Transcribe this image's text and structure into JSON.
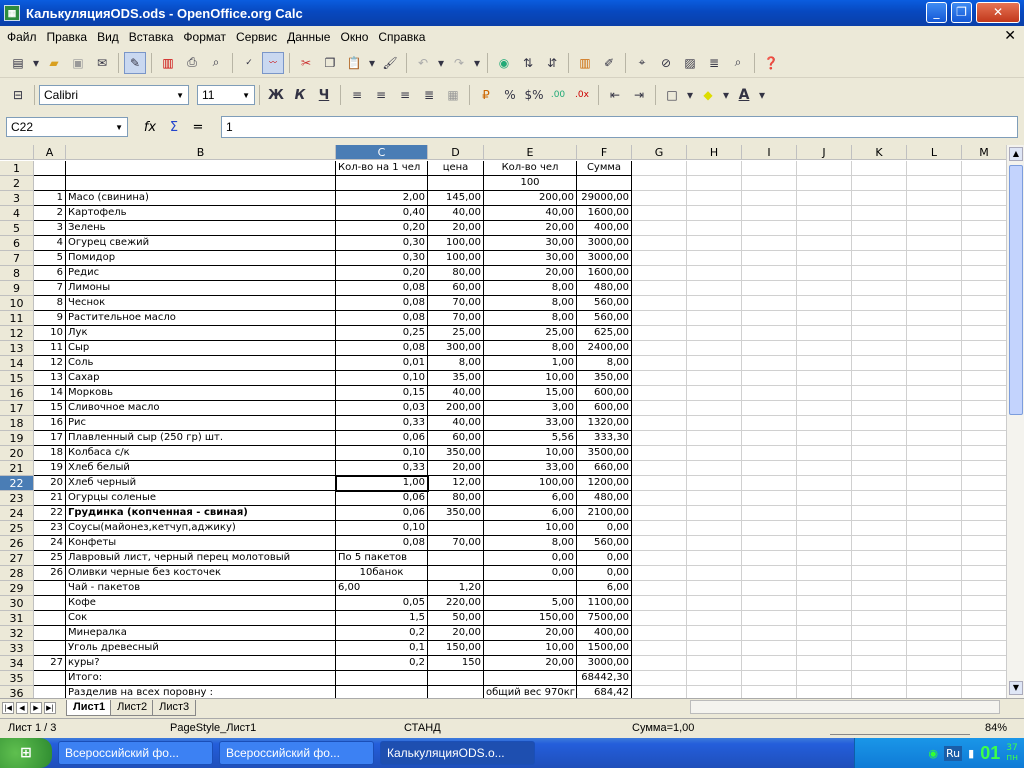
{
  "window": {
    "title": "КалькуляцияODS.ods - OpenOffice.org Calc"
  },
  "menu": [
    "Файл",
    "Правка",
    "Вид",
    "Вставка",
    "Формат",
    "Сервис",
    "Данные",
    "Окно",
    "Справка"
  ],
  "toolbar2": {
    "font": "Calibri",
    "size": "11",
    "bold": "Ж",
    "italic": "К",
    "underline": "Ч",
    "percent": "%"
  },
  "formula": {
    "cellref": "C22",
    "content": "1"
  },
  "columns": [
    {
      "id": "A",
      "w": 32
    },
    {
      "id": "B",
      "w": 270
    },
    {
      "id": "C",
      "w": 92
    },
    {
      "id": "D",
      "w": 56
    },
    {
      "id": "E",
      "w": 93
    },
    {
      "id": "F",
      "w": 55
    },
    {
      "id": "G",
      "w": 55
    },
    {
      "id": "H",
      "w": 55
    },
    {
      "id": "I",
      "w": 55
    },
    {
      "id": "J",
      "w": 55
    },
    {
      "id": "K",
      "w": 55
    },
    {
      "id": "L",
      "w": 55
    },
    {
      "id": "M",
      "w": 45
    }
  ],
  "rows": [
    {
      "n": "1",
      "a": "",
      "b": "",
      "c": "Кол-во на 1 чел",
      "d": "цена",
      "e": "Кол-во  чел",
      "f": "Сумма"
    },
    {
      "n": "2",
      "a": "",
      "b": "",
      "c": "",
      "d": "",
      "e": "100",
      "f": ""
    },
    {
      "n": "3",
      "a": "1",
      "b": "Масо (свинина)",
      "c": "2,00",
      "d": "145,00",
      "e": "200,00",
      "f": "29000,00"
    },
    {
      "n": "4",
      "a": "2",
      "b": "Картофель",
      "c": "0,40",
      "d": "40,00",
      "e": "40,00",
      "f": "1600,00"
    },
    {
      "n": "5",
      "a": "3",
      "b": "Зелень",
      "c": "0,20",
      "d": "20,00",
      "e": "20,00",
      "f": "400,00"
    },
    {
      "n": "6",
      "a": "4",
      "b": "Огурец свежий",
      "c": "0,30",
      "d": "100,00",
      "e": "30,00",
      "f": "3000,00"
    },
    {
      "n": "7",
      "a": "5",
      "b": "Помидор",
      "c": "0,30",
      "d": "100,00",
      "e": "30,00",
      "f": "3000,00"
    },
    {
      "n": "8",
      "a": "6",
      "b": "Редис",
      "c": "0,20",
      "d": "80,00",
      "e": "20,00",
      "f": "1600,00"
    },
    {
      "n": "9",
      "a": "7",
      "b": "Лимоны",
      "c": "0,08",
      "d": "60,00",
      "e": "8,00",
      "f": "480,00"
    },
    {
      "n": "10",
      "a": "8",
      "b": "Чеснок",
      "c": "0,08",
      "d": "70,00",
      "e": "8,00",
      "f": "560,00"
    },
    {
      "n": "11",
      "a": "9",
      "b": "Растительное масло",
      "c": "0,08",
      "d": "70,00",
      "e": "8,00",
      "f": "560,00"
    },
    {
      "n": "12",
      "a": "10",
      "b": "Лук",
      "c": "0,25",
      "d": "25,00",
      "e": "25,00",
      "f": "625,00"
    },
    {
      "n": "13",
      "a": "11",
      "b": "Сыр",
      "c": "0,08",
      "d": "300,00",
      "e": "8,00",
      "f": "2400,00"
    },
    {
      "n": "14",
      "a": "12",
      "b": "Соль",
      "c": "0,01",
      "d": "8,00",
      "e": "1,00",
      "f": "8,00"
    },
    {
      "n": "15",
      "a": "13",
      "b": "Сахар",
      "c": "0,10",
      "d": "35,00",
      "e": "10,00",
      "f": "350,00"
    },
    {
      "n": "16",
      "a": "14",
      "b": "Морковь",
      "c": "0,15",
      "d": "40,00",
      "e": "15,00",
      "f": "600,00"
    },
    {
      "n": "17",
      "a": "15",
      "b": "Сливочное масло",
      "c": "0,03",
      "d": "200,00",
      "e": "3,00",
      "f": "600,00"
    },
    {
      "n": "18",
      "a": "16",
      "b": "Рис",
      "c": "0,33",
      "d": "40,00",
      "e": "33,00",
      "f": "1320,00"
    },
    {
      "n": "19",
      "a": "17",
      "b": "Плавленный сыр (250 гр) шт.",
      "c": "0,06",
      "d": "60,00",
      "e": "5,56",
      "f": "333,30"
    },
    {
      "n": "20",
      "a": "18",
      "b": "Колбаса с/к",
      "c": "0,10",
      "d": "350,00",
      "e": "10,00",
      "f": "3500,00"
    },
    {
      "n": "21",
      "a": "19",
      "b": "Хлеб белый",
      "c": "0,33",
      "d": "20,00",
      "e": "33,00",
      "f": "660,00"
    },
    {
      "n": "22",
      "a": "20",
      "b": "Хлеб черный",
      "c": "1,00",
      "d": "12,00",
      "e": "100,00",
      "f": "1200,00"
    },
    {
      "n": "23",
      "a": "21",
      "b": "Огурцы соленые",
      "c": "0,06",
      "d": "80,00",
      "e": "6,00",
      "f": "480,00"
    },
    {
      "n": "24",
      "a": "22",
      "b": "Грудинка (копченная - свиная)",
      "c": "0,06",
      "d": "350,00",
      "e": "6,00",
      "f": "2100,00",
      "bold": true
    },
    {
      "n": "25",
      "a": "23",
      "b": "Соусы(майонез,кетчуп,аджику)",
      "c": "0,10",
      "d": "",
      "e": "10,00",
      "f": "0,00"
    },
    {
      "n": "26",
      "a": "24",
      "b": "Конфеты",
      "c": "0,08",
      "d": "70,00",
      "e": "8,00",
      "f": "560,00"
    },
    {
      "n": "27",
      "a": "25",
      "b": "Лавровый лист, черный перец молотовый",
      "c": "По 5 пакетов",
      "d": "",
      "e": "0,00",
      "f": "0,00",
      "cl": true
    },
    {
      "n": "28",
      "a": "26",
      "b": "Оливки черные без косточек",
      "c": "10банок",
      "d": "",
      "e": "0,00",
      "f": "0,00",
      "cc": true
    },
    {
      "n": "29",
      "a": "",
      "b": "Чай - пакетов",
      "c": "6,00",
      "d": "1,20",
      "e": "",
      "f": "6,00",
      "cl": true
    },
    {
      "n": "30",
      "a": "",
      "b": "Кофе",
      "c": "0,05",
      "d": "220,00",
      "e": "5,00",
      "f": "1100,00"
    },
    {
      "n": "31",
      "a": "",
      "b": "Сок",
      "c": "1,5",
      "d": "50,00",
      "e": "150,00",
      "f": "7500,00"
    },
    {
      "n": "32",
      "a": "",
      "b": "Минералка",
      "c": "0,2",
      "d": "20,00",
      "e": "20,00",
      "f": "400,00"
    },
    {
      "n": "33",
      "a": "",
      "b": "Уголь древесный",
      "c": "0,1",
      "d": "150,00",
      "e": "10,00",
      "f": "1500,00"
    },
    {
      "n": "34",
      "a": "27",
      "b": "куры?",
      "c": "0,2",
      "d": "150",
      "e": "20,00",
      "f": "3000,00"
    },
    {
      "n": "35",
      "a": "",
      "b": "Итого:",
      "c": "",
      "d": "",
      "e": "",
      "f": "68442,30"
    },
    {
      "n": "36",
      "a": "",
      "b": "Разделив на всех поровну :",
      "c": "",
      "d": "",
      "e": "общий вес 970кг.",
      "f": "684,42",
      "el": true
    }
  ],
  "tabs": [
    "Лист1",
    "Лист2",
    "Лист3"
  ],
  "status": {
    "sheet": "Лист 1 / 3",
    "style": "PageStyle_Лист1",
    "mode": "СТАНД",
    "sum": "Сумма=1,00",
    "zoom": "84%"
  },
  "taskbar": {
    "items": [
      "Всероссийский фо...",
      "Всероссийский фо...",
      "КалькуляцияODS.o..."
    ],
    "lang": "Ru",
    "clock": "01",
    "clock_small_top": "37",
    "clock_small_bottom": "пн"
  }
}
